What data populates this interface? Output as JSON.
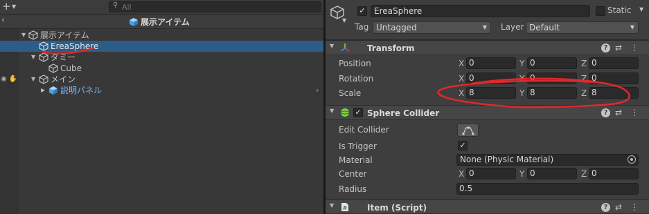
{
  "hierarchy": {
    "add_icon": "plus-icon",
    "search": {
      "placeholder": "All"
    },
    "scene": {
      "back_icon": "chevron-left-icon",
      "title": "展示アイテム"
    },
    "rows": [
      {
        "label": "展示アイテム",
        "icon": "gameobject-cube-icon",
        "expanded": true
      },
      {
        "label": "EreaSphere",
        "icon": "gameobject-cube-icon",
        "selected": true
      },
      {
        "label": "ダミー",
        "icon": "gameobject-cube-icon",
        "expanded": true
      },
      {
        "label": "Cube",
        "icon": "gameobject-cube-icon"
      },
      {
        "label": "メイン",
        "icon": "gameobject-cube-icon",
        "expanded": true
      },
      {
        "label": "説明パネル",
        "icon": "prefab-cube-icon",
        "prefab": true
      }
    ]
  },
  "inspector": {
    "object": {
      "active": true,
      "name": "EreaSphere",
      "static_label": "Static",
      "static": false
    },
    "tag": {
      "label": "Tag",
      "value": "Untagged"
    },
    "layer": {
      "label": "Layer",
      "value": "Default"
    },
    "transform": {
      "title": "Transform",
      "position": {
        "label": "Position",
        "x": "0",
        "y": "0",
        "z": "0"
      },
      "rotation": {
        "label": "Rotation",
        "x": "0",
        "y": "0",
        "z": "0"
      },
      "scale": {
        "label": "Scale",
        "x": "8",
        "y": "8",
        "z": "8"
      }
    },
    "sphere_collider": {
      "title": "Sphere Collider",
      "enabled": true,
      "edit_collider_label": "Edit Collider",
      "is_trigger_label": "Is Trigger",
      "is_trigger": true,
      "material_label": "Material",
      "material_value": "None (Physic Material)",
      "center_label": "Center",
      "center": {
        "x": "0",
        "y": "0",
        "z": "0"
      },
      "radius_label": "Radius",
      "radius": "0.5"
    },
    "item_script": {
      "title": "Item (Script)"
    },
    "axis": {
      "x": "X",
      "y": "Y",
      "z": "Z"
    },
    "header_icons": {
      "help": "?",
      "presets": "⇄",
      "menu": "⋮"
    }
  },
  "colors": {
    "selection": "#2c5d87",
    "prefab_text": "#7ab5ff",
    "annotation_red": "#e0282a",
    "collider_green": "#7fd14b"
  }
}
